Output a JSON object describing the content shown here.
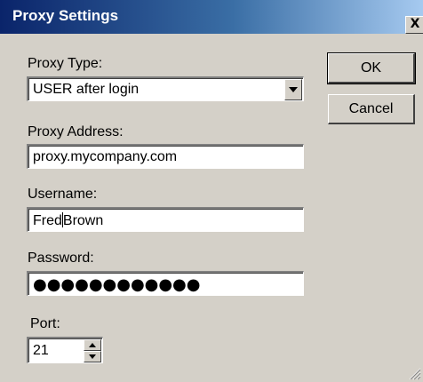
{
  "window": {
    "title": "Proxy Settings",
    "close_label": "X"
  },
  "proxy_type": {
    "label": "Proxy Type:",
    "value": "USER after login"
  },
  "proxy_address": {
    "label": "Proxy Address:",
    "value": "proxy.mycompany.com"
  },
  "username": {
    "label": "Username:",
    "value_before_caret": "Fred",
    "value_after_caret": "Brown"
  },
  "password": {
    "label": "Password:",
    "masked_value": "●●●●●●●●●●●●"
  },
  "port": {
    "label": "Port:",
    "value": "21"
  },
  "buttons": {
    "ok_label": "OK",
    "cancel_label": "Cancel"
  },
  "colors": {
    "dialog_bg": "#d4d0c8",
    "title_start": "#0a246a",
    "title_end": "#a6caf0"
  },
  "icons": {
    "combo_arrow": "chevron-down-icon",
    "spin_up": "spin-up-icon",
    "spin_down": "spin-down-icon",
    "resize_grip": "resize-grip-icon"
  }
}
